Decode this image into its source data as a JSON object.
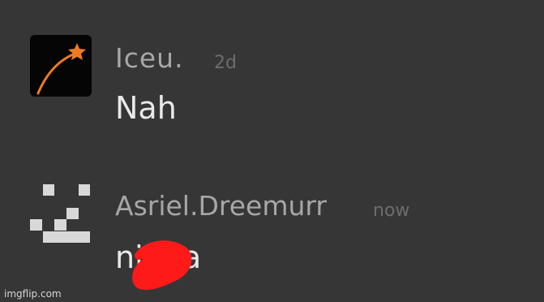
{
  "messages": [
    {
      "avatar": "comet-star-icon",
      "username": "Iceu.",
      "timestamp": "2d",
      "text": "Nah"
    },
    {
      "avatar": "pixel-face-icon",
      "username": "Asriel.Dreemurr",
      "timestamp": "now",
      "text": "nigga",
      "redaction": "red-scribble-censor"
    }
  ],
  "watermark": "imgflip.com",
  "colors": {
    "background": "#363636",
    "username": "#a7a7a7",
    "timestamp": "#6d6d6d",
    "message_text": "#e9e9e9",
    "avatar_star": "#f07a24",
    "redaction": "#ff1a1a"
  }
}
